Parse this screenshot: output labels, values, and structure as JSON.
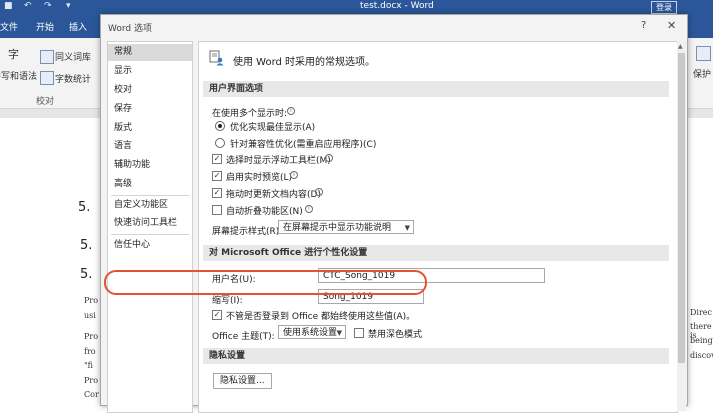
{
  "word": {
    "title": "test.docx  -  Word",
    "login": "登录",
    "tabs": [
      "文件",
      "开始",
      "插入"
    ],
    "ribbon": {
      "thesaurus": "同义词库",
      "spelling_icon_label": "字",
      "spelling_label": "拼写和语法",
      "wordcount": "字数统计",
      "group_proofing": "校对",
      "protect": "保护"
    },
    "doc_lines": {
      "h1": "5.",
      "h2": "5.",
      "h3": "5.",
      "p1": "Pro",
      "p2": "usi",
      "p3": "Pro",
      "p4": "fro",
      "p5": "\"fi",
      "p6": "Pro",
      "p7": "Cor",
      "r1": "Direc",
      "r2": "there is",
      "r3": "being",
      "r4": "discove"
    }
  },
  "dialog": {
    "title": "Word 选项",
    "help": "?",
    "close": "✕",
    "nav": [
      {
        "label": "常规",
        "selected": true
      },
      {
        "label": "显示"
      },
      {
        "label": "校对"
      },
      {
        "label": "保存"
      },
      {
        "label": "版式"
      },
      {
        "label": "语言"
      },
      {
        "label": "辅助功能"
      },
      {
        "label": "高级"
      },
      {
        "label": "自定义功能区"
      },
      {
        "label": "快速访问工具栏"
      },
      {
        "label": "信任中心"
      }
    ],
    "header": "使用 Word 时采用的常规选项。",
    "ui_section": "用户界面选项",
    "multi_display_label": "在使用多个显示时:",
    "radio_optimize": "优化实现最佳显示(A)",
    "radio_compat": "针对兼容性优化(需重启应用程序)(C)",
    "chk_minitoolbar": "选择时显示浮动工具栏(M)",
    "chk_livepreview": "启用实时预览(L)",
    "chk_dragupdate": "拖动时更新文档内容(D)",
    "chk_collapse": "自动折叠功能区(N)",
    "screentip_label": "屏幕提示样式(R):",
    "screentip_value": "在屏幕提示中显示功能说明",
    "personal_section": "对 Microsoft Office 进行个性化设置",
    "username_label": "用户名(U):",
    "username_value": "CTC_Song_1019",
    "initials_label": "缩写(I):",
    "initials_value": "Song_1019",
    "chk_always_use": "不管是否登录到 Office 都始终使用这些值(A)。",
    "theme_label": "Office 主题(T):",
    "theme_value": "使用系统设置",
    "chk_dark": "禁用深色模式",
    "privacy_section": "隐私设置",
    "privacy_button": "隐私设置..."
  },
  "colors": {
    "accent": "#2b579a",
    "highlight": "#e05434"
  }
}
